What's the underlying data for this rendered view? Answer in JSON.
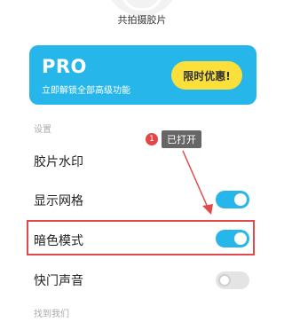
{
  "header": {
    "shot_count_label": "共拍摄胶片"
  },
  "pro_card": {
    "title": "PRO",
    "subtitle": "立即解锁全部高级功能",
    "button_label": "限时优惠!"
  },
  "settings": {
    "section_title": "设置",
    "items": [
      {
        "label": "胶片水印",
        "toggle": null
      },
      {
        "label": "显示网格",
        "toggle": "on"
      },
      {
        "label": "暗色模式",
        "toggle": "on"
      },
      {
        "label": "快门声音",
        "toggle": "off"
      }
    ]
  },
  "find_us": {
    "section_title": "找到我们"
  },
  "annotation": {
    "step_number": "1",
    "text": "已打开",
    "highlight_color": "#e04a4a"
  },
  "colors": {
    "accent": "#27b6ea",
    "promo_button": "#fbe03b",
    "toggle_off": "#e4e4e4"
  },
  "icons": [
    "shutter-icon"
  ]
}
